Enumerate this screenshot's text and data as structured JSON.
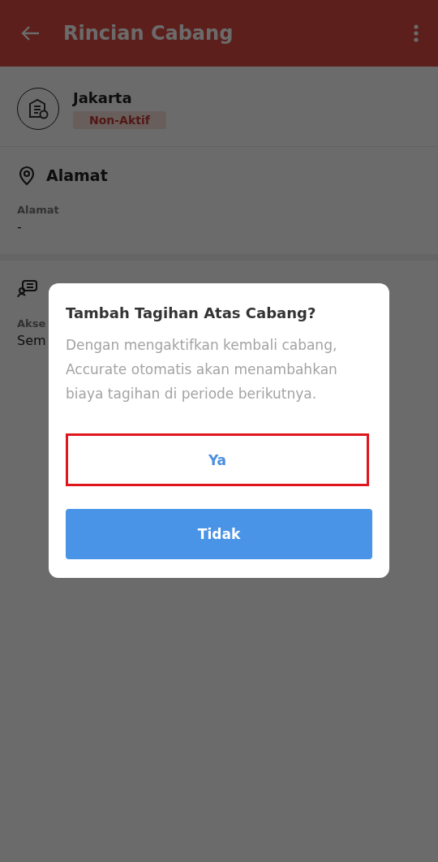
{
  "app_bar": {
    "title": "Rincian Cabang"
  },
  "branch": {
    "name": "Jakarta",
    "status": "Non-Aktif",
    "active": false
  },
  "sections": [
    {
      "title": "Alamat",
      "kind": "address",
      "fields": [
        {
          "label": "Alamat",
          "value": "-"
        }
      ]
    },
    {
      "kind": "access",
      "fields": [
        {
          "label": "Akse",
          "value": "Sem"
        }
      ]
    }
  ],
  "dialog": {
    "title": "Tambah Tagihan Atas Cabang?",
    "message": "Dengan mengaktifkan kembali cabang, Accurate otomatis akan menambahkan biaya tagihan di periode berikutnya.",
    "buttons": [
      {
        "label": "Ya",
        "kind": "outline",
        "highlighted": true
      },
      {
        "label": "Tidak",
        "kind": "primary",
        "highlighted": false
      }
    ]
  }
}
